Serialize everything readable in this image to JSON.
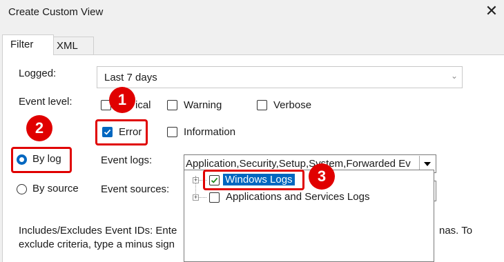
{
  "window": {
    "title": "Create Custom View",
    "close_glyph": "✕"
  },
  "tabs": [
    {
      "label": "Filter"
    },
    {
      "label": "XML"
    }
  ],
  "filter": {
    "logged_label": "Logged:",
    "logged_value": "Last 7 days",
    "event_level_label": "Event level:",
    "levels": [
      {
        "label": "Critical",
        "visible_label": "ical",
        "checked": false
      },
      {
        "label": "Warning",
        "checked": false
      },
      {
        "label": "Verbose",
        "checked": false
      },
      {
        "label": "Error",
        "checked": true
      },
      {
        "label": "Information",
        "checked": false
      }
    ],
    "by_log_label": "By log",
    "by_source_label": "By source",
    "event_logs_label": "Event logs:",
    "event_logs_value": "Application,Security,Setup,System,Forwarded Ev",
    "event_sources_label": "Event sources:",
    "tree": [
      {
        "label": "Windows Logs",
        "checked": true,
        "selected": true
      },
      {
        "label": "Applications and Services Logs",
        "checked": false,
        "selected": false
      }
    ],
    "help_line1_start": "Includes/Excludes Event IDs: Ente",
    "help_line1_end": "nas. To",
    "help_line2": "exclude criteria, type a minus sign"
  },
  "annotations": [
    {
      "number": "1"
    },
    {
      "number": "2"
    },
    {
      "number": "3"
    }
  ],
  "colors": {
    "accent": "#0067c0",
    "callout": "#e00000"
  }
}
